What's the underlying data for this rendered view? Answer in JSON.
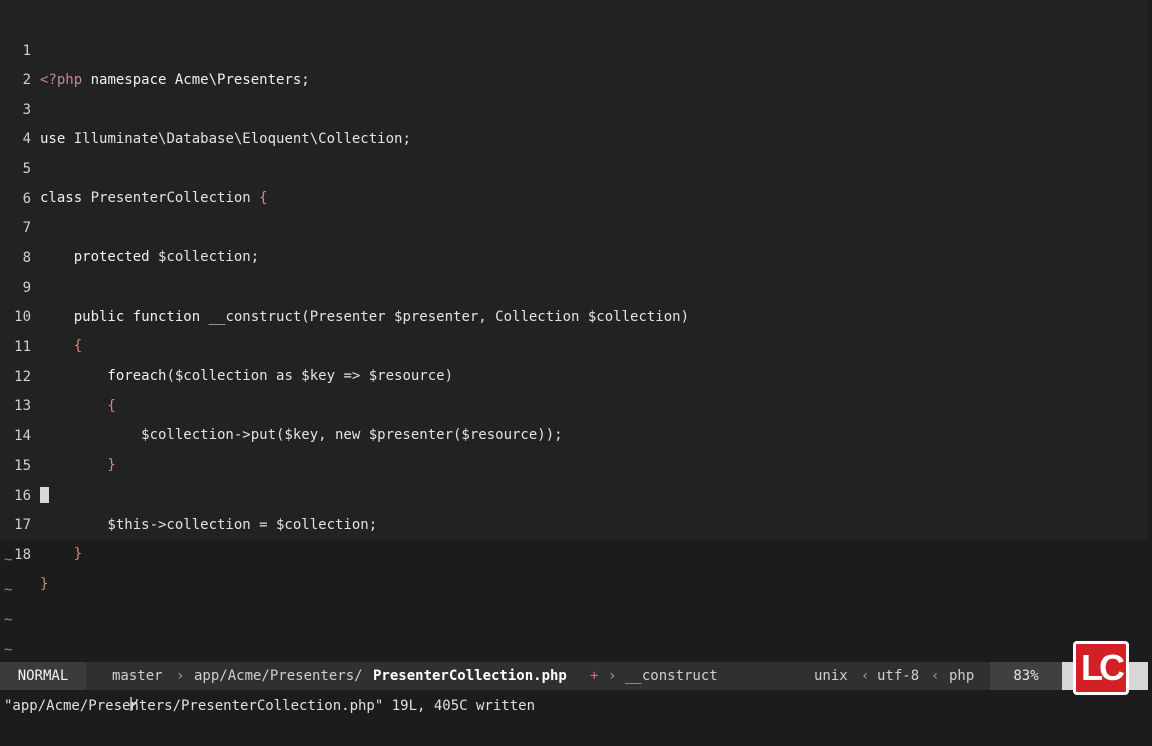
{
  "editor": {
    "lines": [
      {
        "n": "1"
      },
      {
        "n": "2"
      },
      {
        "n": "3"
      },
      {
        "n": "4"
      },
      {
        "n": "5"
      },
      {
        "n": "6"
      },
      {
        "n": "7"
      },
      {
        "n": "8"
      },
      {
        "n": "9"
      },
      {
        "n": "10"
      },
      {
        "n": "11"
      },
      {
        "n": "12"
      },
      {
        "n": "13"
      },
      {
        "n": "14"
      },
      {
        "n": "15"
      },
      {
        "n": "16"
      },
      {
        "n": "17"
      },
      {
        "n": "18"
      }
    ],
    "code": {
      "l1_open": "<?php",
      "l1_rest": " namespace Acme\\Presenters;",
      "l3_use": "use",
      "l3_rest": " Illuminate\\Database\\Eloquent\\Collection;",
      "l5_class": "class",
      "l5_name": " PresenterCollection ",
      "l5_brace": "{",
      "l7_kw": "    protected",
      "l7_var": " $collection;",
      "l9_kw": "    public function",
      "l9_rest": " __construct(Presenter $presenter, Collection $collection)",
      "l10": "    {",
      "l11_kw": "        foreach",
      "l11_rest": "($collection as $key => $resource)",
      "l12": "        {",
      "l13": "            $collection->put($key, new $presenter($resource));",
      "l14": "        }",
      "l16": "        $this->collection = $collection;",
      "l17": "    }",
      "l18": "}"
    },
    "empty_line_marker": "~"
  },
  "statusbar": {
    "mode": "NORMAL",
    "branch_icon": "git-branch-icon",
    "branch": "master",
    "path_dir": "app/Acme/Presenters/",
    "path_file": "PresenterCollection.php",
    "modified_marker": "+",
    "function": "__construct",
    "fileformat": "unix",
    "encoding": "utf-8",
    "filetype": "php",
    "percent": "83%"
  },
  "cmdline": "\"app/Acme/Presenters/PresenterCollection.php\" 19L, 405C written",
  "logo_text": "LC"
}
